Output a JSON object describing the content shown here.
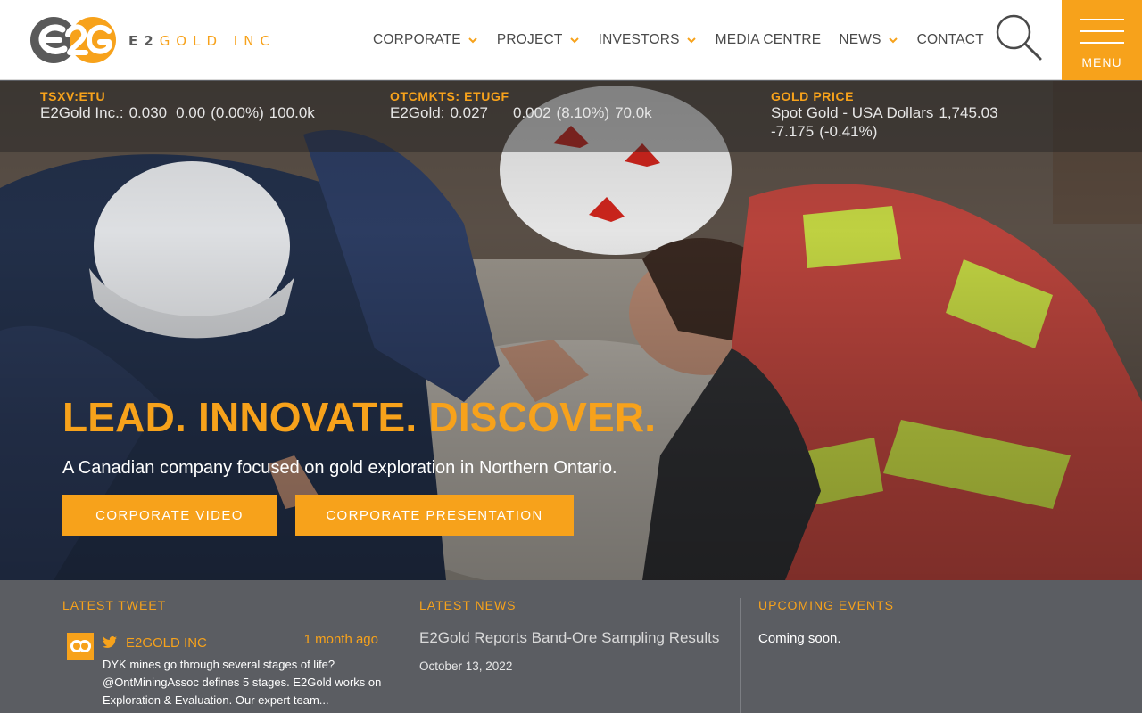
{
  "header": {
    "logo_text_a": "E2",
    "logo_text_b": "GOLD INC",
    "nav": [
      {
        "label": "CORPORATE",
        "has_dropdown": true
      },
      {
        "label": "PROJECT",
        "has_dropdown": true
      },
      {
        "label": "INVESTORS",
        "has_dropdown": true
      },
      {
        "label": "MEDIA CENTRE",
        "has_dropdown": false
      },
      {
        "label": "NEWS",
        "has_dropdown": true
      },
      {
        "label": "CONTACT",
        "has_dropdown": false
      }
    ],
    "search_icon": "search-icon",
    "menu_label": "MENU"
  },
  "ticker": {
    "tsxv": {
      "title": "TSXV:ETU",
      "name": "E2Gold Inc.:",
      "price": "0.030",
      "change": "0.00",
      "pct": "(0.00%)",
      "volume": "100.0k"
    },
    "otc": {
      "title": "OTCMKTS: ETUGF",
      "name": "E2Gold:",
      "price": "0.027",
      "change": "0.002",
      "pct": "(8.10%)",
      "volume": "70.0k"
    },
    "gold": {
      "title": "GOLD PRICE",
      "name": "Spot Gold - USA Dollars",
      "price": "1,745.03",
      "change": "-7.175",
      "pct": "(-0.41%)"
    }
  },
  "hero": {
    "headline": "LEAD. INNOVATE. DISCOVER.",
    "subline": "A Canadian company focused on gold exploration in Northern Ontario.",
    "btn_video": "CORPORATE VIDEO",
    "btn_presentation": "CORPORATE PRESENTATION"
  },
  "latest_tweet": {
    "heading": "LATEST TWEET",
    "user": "E2GOLD INC",
    "time": "1 month ago",
    "text": "DYK mines go through several stages of life? @OntMiningAssoc defines 5 stages.  E2Gold works on Exploration & Evaluation. Our expert team..."
  },
  "latest_news": {
    "heading": "LATEST NEWS",
    "title": "E2Gold Reports Band-Ore Sampling Results",
    "date": "October 13, 2022"
  },
  "upcoming_events": {
    "heading": "UPCOMING EVENTS",
    "text": "Coming soon."
  },
  "colors": {
    "accent": "#f7a21b",
    "strip_bg": "#5b5d62",
    "nav_text": "#4a4a4a"
  }
}
